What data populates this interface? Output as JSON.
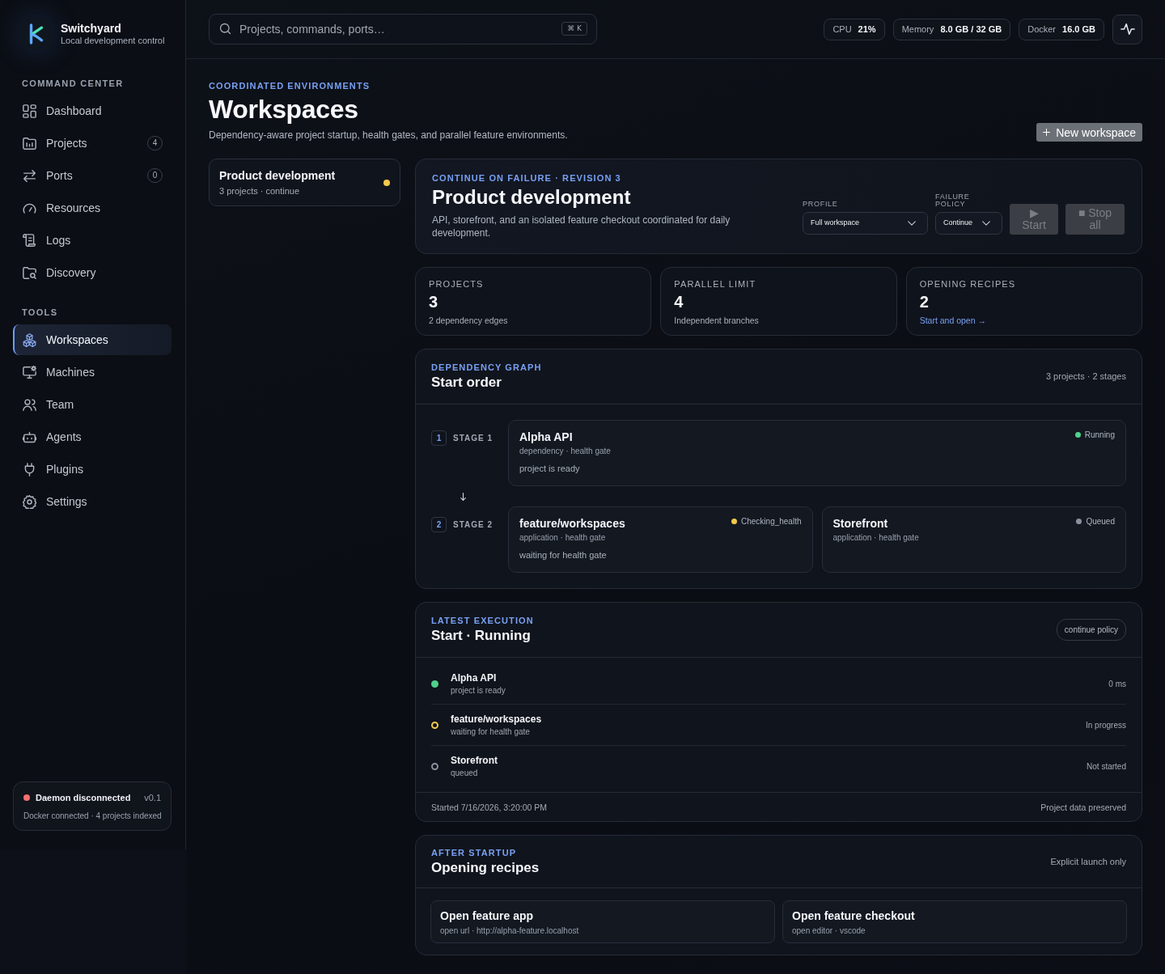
{
  "app": {
    "name": "Switchyard",
    "tagline": "Local development control"
  },
  "sidebar": {
    "sections": [
      {
        "heading": "COMMAND CENTER",
        "items": [
          {
            "label": "Dashboard",
            "selected": false
          },
          {
            "label": "Projects",
            "count": "4",
            "selected": false
          },
          {
            "label": "Ports",
            "count": "0",
            "selected": false
          },
          {
            "label": "Resources",
            "selected": false
          },
          {
            "label": "Logs",
            "selected": false
          },
          {
            "label": "Discovery",
            "selected": false
          }
        ]
      },
      {
        "heading": "TOOLS",
        "items": [
          {
            "label": "Workspaces",
            "selected": true
          },
          {
            "label": "Machines",
            "selected": false
          },
          {
            "label": "Team",
            "selected": false
          },
          {
            "label": "Agents",
            "selected": false
          },
          {
            "label": "Plugins",
            "selected": false
          },
          {
            "label": "Settings",
            "selected": false
          }
        ]
      }
    ],
    "status": {
      "title": "Daemon disconnected",
      "version": "v0.1",
      "detail": "Docker connected · 4 projects indexed",
      "color": "#f0716f"
    }
  },
  "topbar": {
    "search": {
      "placeholder": "Projects, commands, ports…",
      "shortcut": "⌘ K"
    },
    "metrics": [
      {
        "label": "CPU",
        "value": "21%"
      },
      {
        "label": "Memory",
        "value": "8.0 GB / 32 GB"
      },
      {
        "label": "Docker",
        "value": "16.0 GB"
      }
    ]
  },
  "header": {
    "eyebrow": "COORDINATED ENVIRONMENTS",
    "title": "Workspaces",
    "description": "Dependency-aware project startup, health gates, and parallel feature environments.",
    "new_button": "New workspace"
  },
  "workspaces": [
    {
      "title": "Product development",
      "subtitle": "3 projects · continue",
      "color": "#f2c94c"
    }
  ],
  "hero": {
    "eyebrow": "CONTINUE ON FAILURE · REVISION 3",
    "title": "Product development",
    "description": "API, storefront, and an isolated feature checkout coordinated for daily development.",
    "profile": {
      "label": "PROFILE",
      "value": "Full workspace"
    },
    "policy": {
      "label": "FAILURE POLICY",
      "value": "Continue"
    },
    "actions": [
      {
        "label": "▶ Start",
        "disabled": true
      },
      {
        "label": "■ Stop all",
        "disabled": true
      }
    ]
  },
  "stats": [
    {
      "label": "PROJECTS",
      "value": "3",
      "note": "2 dependency edges",
      "kind": "text"
    },
    {
      "label": "PARALLEL LIMIT",
      "value": "4",
      "note": "Independent branches",
      "kind": "text"
    },
    {
      "label": "OPENING RECIPES",
      "value": "2",
      "note": "Start and open →",
      "kind": "link"
    }
  ],
  "graph": {
    "eyebrow": "DEPENDENCY GRAPH",
    "title": "Start order",
    "summary": "3 projects · 2 stages",
    "stages": [
      {
        "number": "1",
        "label": "STAGE 1",
        "projects": [
          {
            "name": "Alpha API",
            "meta": "dependency · health gate",
            "message": "project is ready",
            "status": "Running",
            "color": "#4fd18b"
          }
        ]
      },
      {
        "number": "2",
        "label": "STAGE 2",
        "projects": [
          {
            "name": "feature/workspaces",
            "meta": "application · health gate",
            "message": "waiting for health gate",
            "status": "Checking_health",
            "color": "#f2c94c"
          },
          {
            "name": "Storefront",
            "meta": "application · health gate",
            "status": "Queued",
            "color": "#8a919e"
          }
        ]
      }
    ]
  },
  "execution": {
    "eyebrow": "LATEST EXECUTION",
    "title": "Start · Running",
    "badge": "continue policy",
    "steps": [
      {
        "name": "Alpha API",
        "detail": "project is ready",
        "result": "0 ms",
        "kind": "filled",
        "color": "#4fd18b"
      },
      {
        "name": "feature/workspaces",
        "detail": "waiting for health gate",
        "result": "In progress",
        "kind": "ring",
        "color": "#f2c94c"
      },
      {
        "name": "Storefront",
        "detail": "queued",
        "result": "Not started",
        "kind": "ring",
        "color": "#8a919e"
      }
    ],
    "started": "Started 7/16/2026, 3:20:00 PM",
    "note": "Project data preserved"
  },
  "recipes": {
    "eyebrow": "AFTER STARTUP",
    "title": "Opening recipes",
    "note": "Explicit launch only",
    "items": [
      {
        "title": "Open feature app",
        "detail": "open url · http://alpha-feature.localhost"
      },
      {
        "title": "Open feature checkout",
        "detail": "open editor · vscode"
      }
    ]
  }
}
